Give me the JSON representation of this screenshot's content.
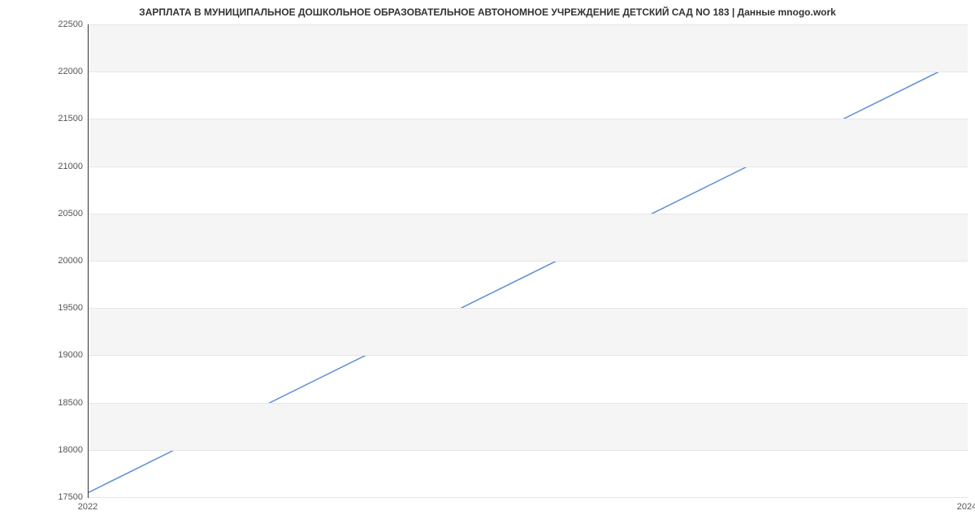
{
  "chart_data": {
    "type": "line",
    "title": "ЗАРПЛАТА В МУНИЦИПАЛЬНОЕ ДОШКОЛЬНОЕ ОБРАЗОВАТЕЛЬНОЕ АВТОНОМНОЕ УЧРЕЖДЕНИЕ  ДЕТСКИЙ САД NО 183 | Данные mnogo.work",
    "x": [
      2022,
      2024
    ],
    "values": [
      17550,
      22150
    ],
    "xlabel": "",
    "ylabel": "",
    "xlim": [
      2022,
      2024
    ],
    "ylim": [
      17500,
      22500
    ],
    "y_ticks": [
      17500,
      18000,
      18500,
      19000,
      19500,
      20000,
      20500,
      21000,
      21500,
      22000,
      22500
    ],
    "x_ticks": [
      2022,
      2024
    ],
    "line_color": "#5b8fd6"
  }
}
